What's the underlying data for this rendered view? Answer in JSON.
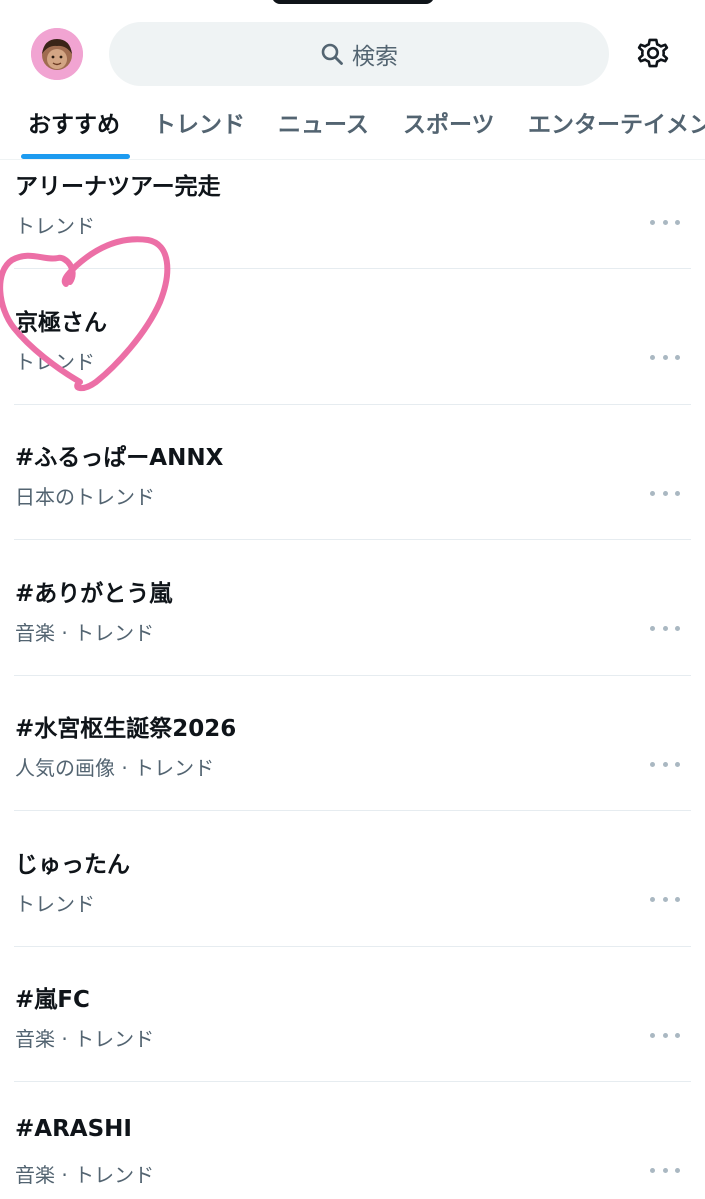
{
  "search": {
    "label": "検索"
  },
  "tabs": [
    {
      "label": "おすすめ",
      "active": true
    },
    {
      "label": "トレンド",
      "active": false
    },
    {
      "label": "ニュース",
      "active": false
    },
    {
      "label": "スポーツ",
      "active": false
    },
    {
      "label": "エンターテイメン",
      "active": false
    }
  ],
  "trends": [
    {
      "title": "アリーナツアー完走",
      "meta": "トレンド"
    },
    {
      "title": "京極さん",
      "meta": "トレンド"
    },
    {
      "title": "#ふるっぱーANNX",
      "meta": "日本のトレンド"
    },
    {
      "title": "#ありがとう嵐",
      "meta": "音楽 · トレンド"
    },
    {
      "title": "#水宮枢生誕祭2026",
      "meta": "人気の画像 · トレンド"
    },
    {
      "title": "じゅったん",
      "meta": "トレンド"
    },
    {
      "title": "#嵐FC",
      "meta": "音楽 · トレンド"
    },
    {
      "title": "#ARASHI",
      "meta": "音楽 · トレンド"
    }
  ],
  "colors": {
    "accent": "#1d9bf0",
    "text_primary": "#0f1419",
    "text_secondary": "#536471",
    "search_bg": "#eff3f4",
    "doodle": "#ec6fa6",
    "avatar_bg": "#f1a4d2"
  },
  "icons": {
    "search": "magnifier-icon",
    "settings": "gear-icon",
    "more": "more-horizontal-icon",
    "doodle": "heart-doodle-icon"
  }
}
